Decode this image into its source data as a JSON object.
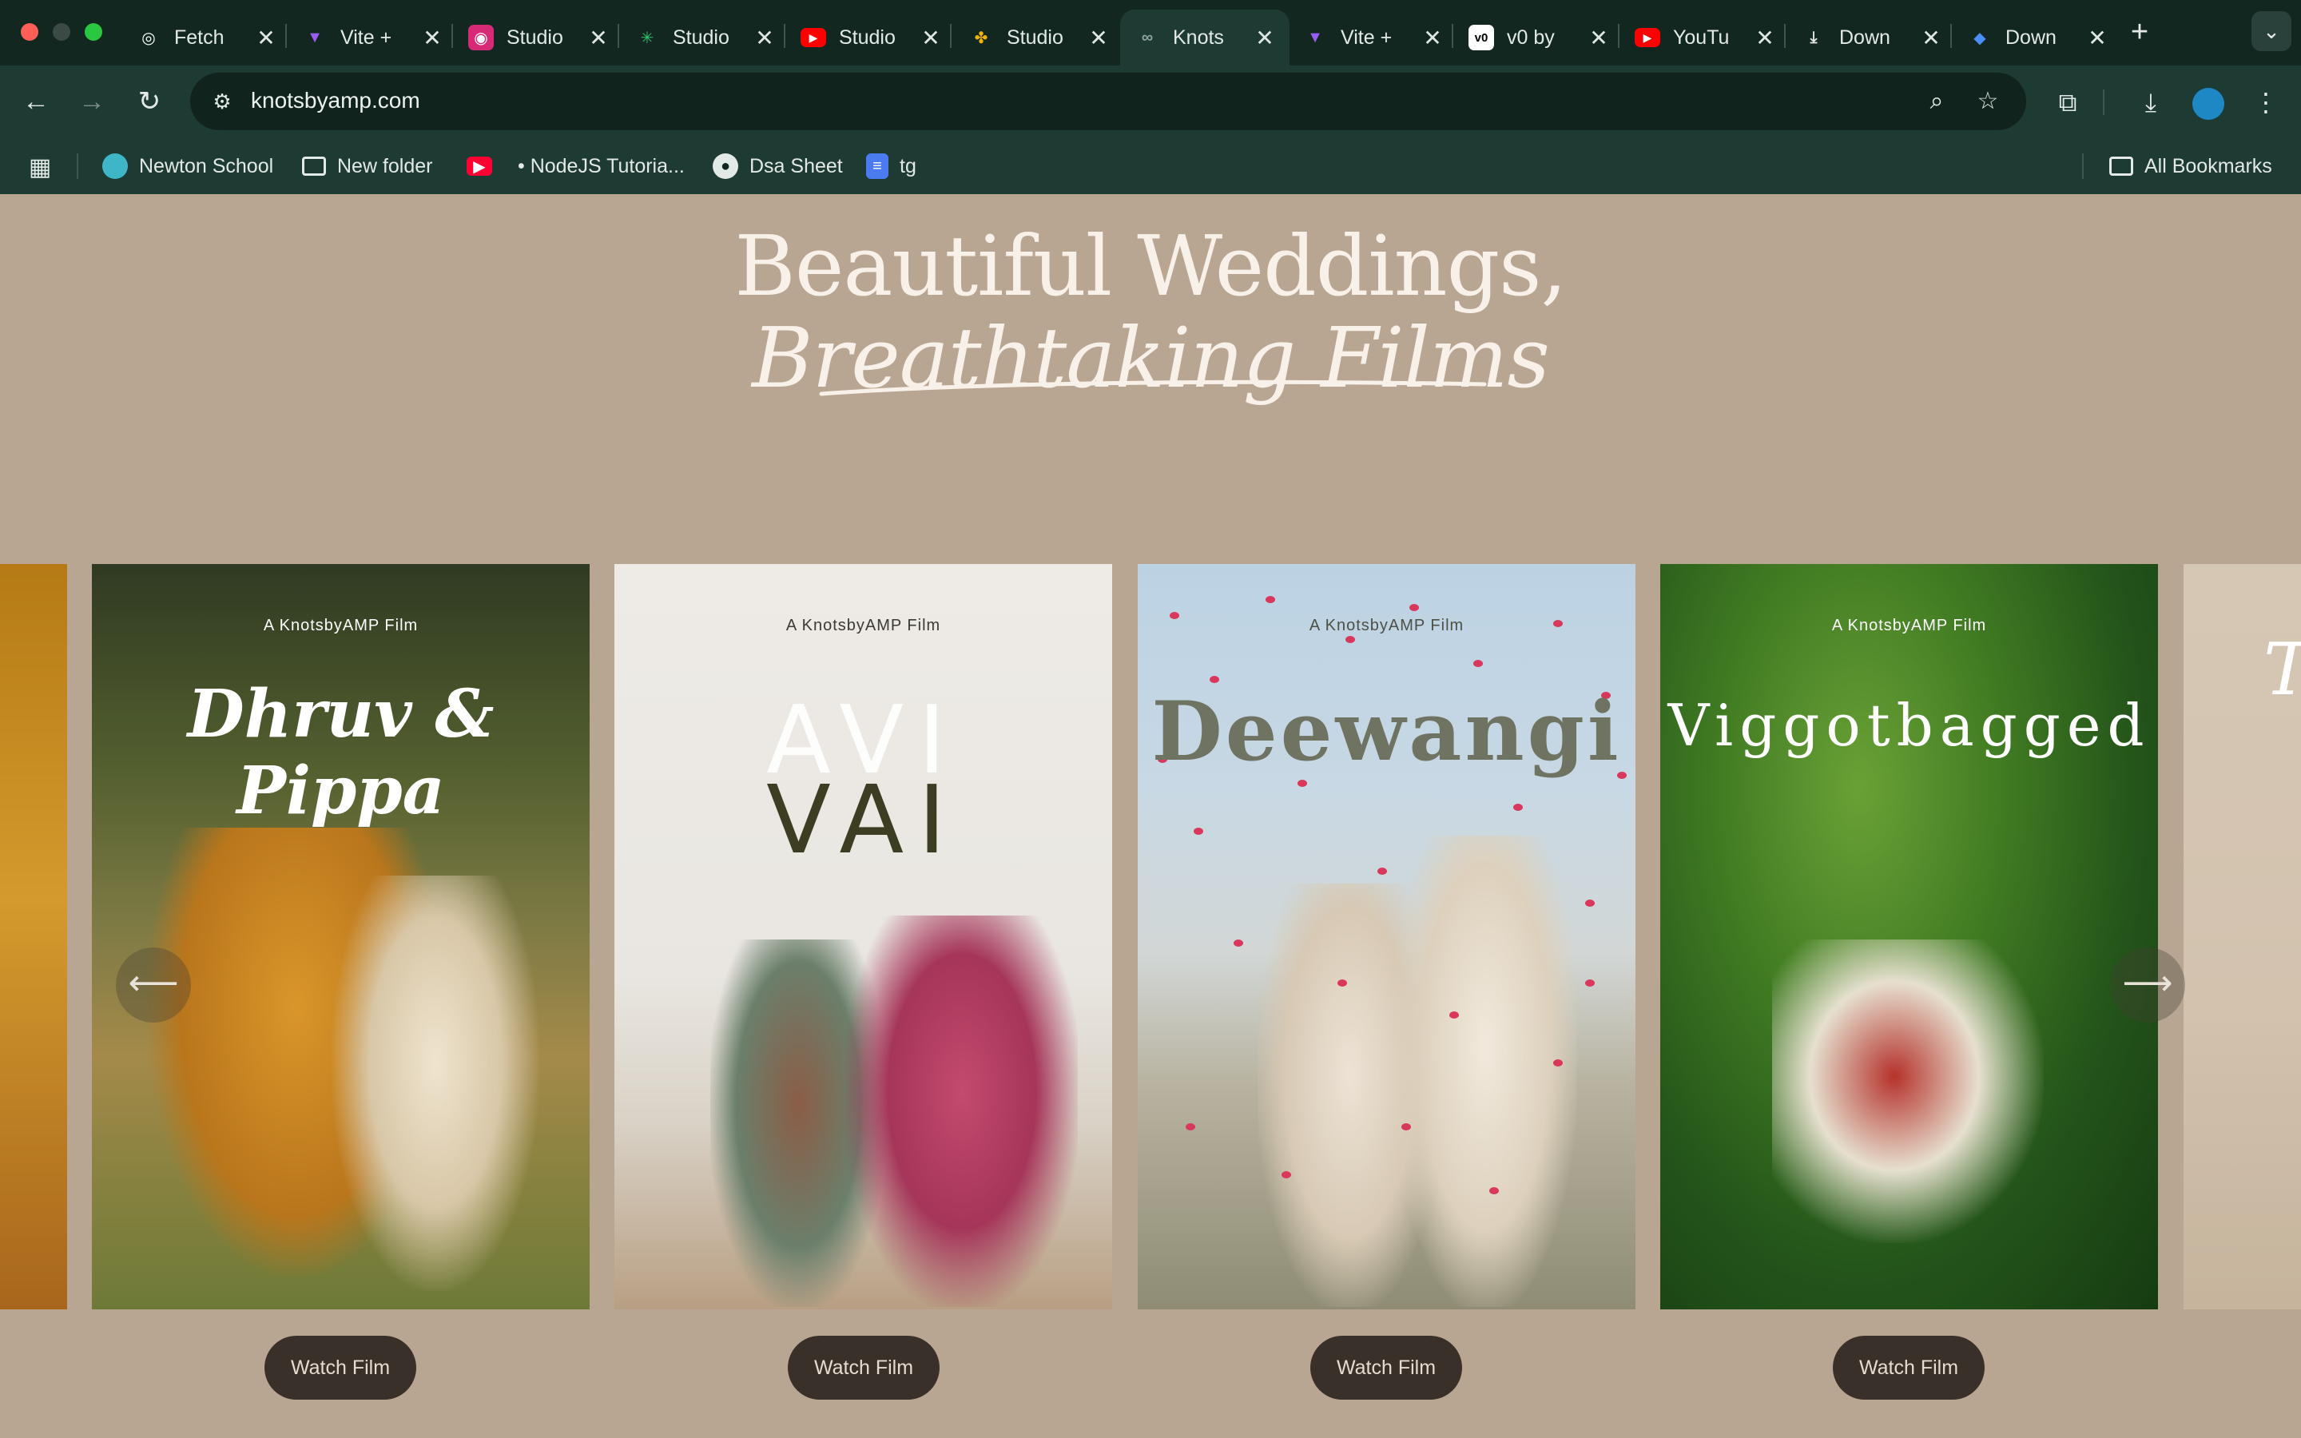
{
  "browser": {
    "tabs": [
      {
        "title": "Fetch",
        "icon": "chatgpt-icon",
        "color": "#ffffff"
      },
      {
        "title": "Vite +",
        "icon": "vite-icon",
        "color": "#9a5cf6"
      },
      {
        "title": "Studio",
        "icon": "instagram-icon",
        "color": "#d62976"
      },
      {
        "title": "Studio",
        "icon": "sparkle-icon",
        "color": "#31c46b"
      },
      {
        "title": "Studio",
        "icon": "youtube-icon",
        "color": "#ff0000"
      },
      {
        "title": "Studio",
        "icon": "pinwheel-icon",
        "color": "#f4b400"
      },
      {
        "title": "Knots",
        "icon": "knots-icon",
        "color": "#8fa39d",
        "active": true
      },
      {
        "title": "Vite +",
        "icon": "vite-icon",
        "color": "#9a5cf6"
      },
      {
        "title": "v0 by",
        "icon": "v0-icon",
        "color": "#ffffff"
      },
      {
        "title": "YouTu",
        "icon": "youtube-icon",
        "color": "#ff0000"
      },
      {
        "title": "Down",
        "icon": "download-icon",
        "color": "#e3e9e6"
      },
      {
        "title": "Down",
        "icon": "gem-icon",
        "color": "#4b8ef7"
      }
    ],
    "url": "knotsbyamp.com",
    "bookmarks": [
      {
        "label": "Newton School",
        "icon": "newton-icon",
        "color": "#3fb6c8"
      },
      {
        "label": "New folder",
        "icon": "folder-icon",
        "color": ""
      },
      {
        "label": "",
        "icon": "youtube-icon",
        "color": "#ff0033"
      },
      {
        "label": "• NodeJS Tutoria...",
        "icon": "",
        "color": ""
      },
      {
        "label": "Dsa Sheet",
        "icon": "github-icon",
        "color": ""
      },
      {
        "label": "tg",
        "icon": "docs-icon",
        "color": "#4b7bf0"
      }
    ],
    "all_bookmarks": "All Bookmarks"
  },
  "hero": {
    "line1": "Beautiful Weddings,",
    "line2": "Breathtaking Films"
  },
  "films": [
    {
      "credit": "A KnotsbyAMP Film",
      "couple": "Dhruv & Pippa",
      "cta": "Watch Film"
    },
    {
      "credit": "A KnotsbyAMP Film",
      "couple_line1": "AVI",
      "couple_line2": "VAI",
      "cta": "Watch Film"
    },
    {
      "credit": "A KnotsbyAMP Film",
      "couple": "Deewangi",
      "cta": "Watch Film"
    },
    {
      "credit": "A KnotsbyAMP Film",
      "couple": "Viggotbagged",
      "cta": "Watch Film"
    }
  ],
  "carousel": {
    "prev_icon": "arrow-left-icon",
    "next_icon": "arrow-right-icon"
  }
}
